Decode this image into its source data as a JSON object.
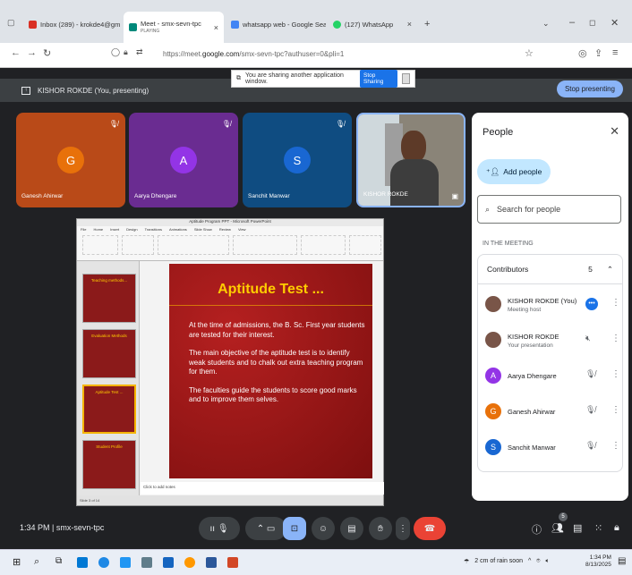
{
  "browser": {
    "tabs": [
      {
        "label": "Inbox (289) - krokde4@gmail.c...",
        "icon": "gmail-icon",
        "color": "#d93025"
      },
      {
        "label": "Meet - smx-sevn-tpc",
        "sublabel": "PLAYING",
        "icon": "meet-icon",
        "color": "#00897b"
      },
      {
        "label": "whatsapp web - Google Search",
        "icon": "google-icon",
        "color": "#4285f4"
      },
      {
        "label": "(127) WhatsApp",
        "icon": "whatsapp-icon",
        "color": "#25d366"
      }
    ],
    "close_glyph": "×",
    "new_tab_glyph": "+",
    "url_prefix": "https://meet.",
    "url_domain": "google.com",
    "url_suffix": "/smx-sevn-tpc?authuser=0&pli=1"
  },
  "share_banner": {
    "text": "You are sharing another application window.",
    "stop_label": "Stop Sharing"
  },
  "meet_bar": {
    "presenter": "KISHOR ROKDE (You, presenting)",
    "stop_label": "Stop presenting"
  },
  "tiles": [
    {
      "initial": "G",
      "name": "Ganesh Ahirwar",
      "bg": "#b94a18",
      "avatar": "#e8710a"
    },
    {
      "initial": "A",
      "name": "Aarya Dhengare",
      "bg": "#6a2c91",
      "avatar": "#9334e6"
    },
    {
      "initial": "S",
      "name": "Sanchit Manwar",
      "bg": "#0f4c81",
      "avatar": "#1967d2"
    },
    {
      "name": "KISHOR ROKDE"
    }
  ],
  "ppt": {
    "title": "Aptitude Program PPT - Microsoft PowerPoint",
    "menu": [
      "File",
      "Home",
      "Insert",
      "Design",
      "Transitions",
      "Animations",
      "Slide Show",
      "Review",
      "View"
    ],
    "thumbs": [
      "Teaching methods...",
      "Evaluation Methods",
      "Aptitude Test ...",
      "Student Profile"
    ],
    "slide_title": "Aptitude Test ...",
    "slide_paragraphs": [
      "At the time of admissions, the B. Sc. First year students are tested for their interest.",
      "The main objective of the aptitude test is to identify weak students and to chalk out extra teaching program for them.",
      "The faculties guide the students to score good marks and to improve them selves."
    ],
    "notes": "Click to add notes",
    "status": "Slide 3 of 14"
  },
  "people": {
    "title": "People",
    "add_label": "Add people",
    "search_placeholder": "Search for people",
    "section": "IN THE MEETING",
    "group": "Contributors",
    "count": "5",
    "list": [
      {
        "name": "KISHOR ROKDE (You)",
        "sub": "Meeting host",
        "initial": "",
        "color": "#795548",
        "mic": "speaking"
      },
      {
        "name": "KISHOR ROKDE",
        "sub": "Your presentation",
        "initial": "",
        "color": "#795548",
        "mic": "muted"
      },
      {
        "name": "Aarya Dhengare",
        "sub": "",
        "initial": "A",
        "color": "#9334e6",
        "mic": "muted"
      },
      {
        "name": "Ganesh Ahirwar",
        "sub": "",
        "initial": "G",
        "color": "#e8710a",
        "mic": "muted"
      },
      {
        "name": "Sanchit Manwar",
        "sub": "",
        "initial": "S",
        "color": "#1967d2",
        "mic": "muted"
      }
    ]
  },
  "bottom": {
    "meeting": "1:34 PM  |  smx-sevn-tpc",
    "people_badge": "5"
  },
  "taskbar": {
    "weather": "2 cm of rain soon",
    "time": "1:34 PM",
    "date": "8/13/2025"
  }
}
